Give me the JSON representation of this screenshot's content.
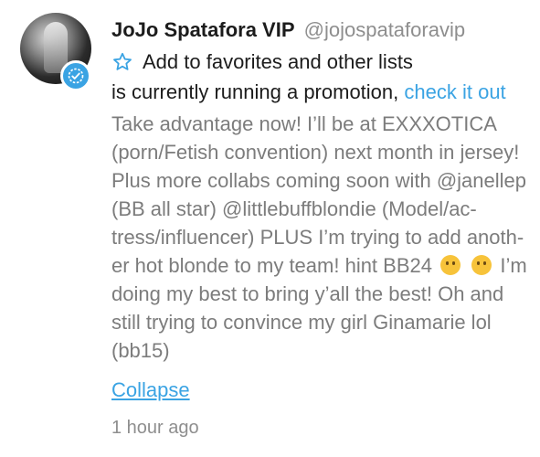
{
  "post": {
    "display_name": "JoJo Spatafora VIP",
    "username": "@jojospataforavip",
    "favorites_label": "Add to favorites and other lists",
    "promo_text": "is currently running a promotion,",
    "promo_link": "check it out",
    "message_lines": [
      "Take advantage now! I’ll be at EXXXOTICA",
      "(porn/Fetish convention) next month in jersey!",
      "Plus more collabs coming soon with @janellep",
      "(BB all star) @littlebuffblondie (Model/ac-",
      "tress/influencer) PLUS I’m trying to add anoth-",
      "er hot blonde to my team! hint BB24",
      "I’m",
      "doing my best to bring y’all the best! Oh and",
      "still trying to convince my girl Ginamarie lol",
      "(bb15)"
    ],
    "emojis": [
      "shushing-face-emoji",
      "winking-face-emoji"
    ],
    "collapse_label": "Collapse",
    "timestamp": "1 hour ago"
  },
  "colors": {
    "accent": "#3aa3e3",
    "name": "#1c1c1c",
    "muted": "#8e8e8e",
    "message": "#7c7c7c"
  }
}
